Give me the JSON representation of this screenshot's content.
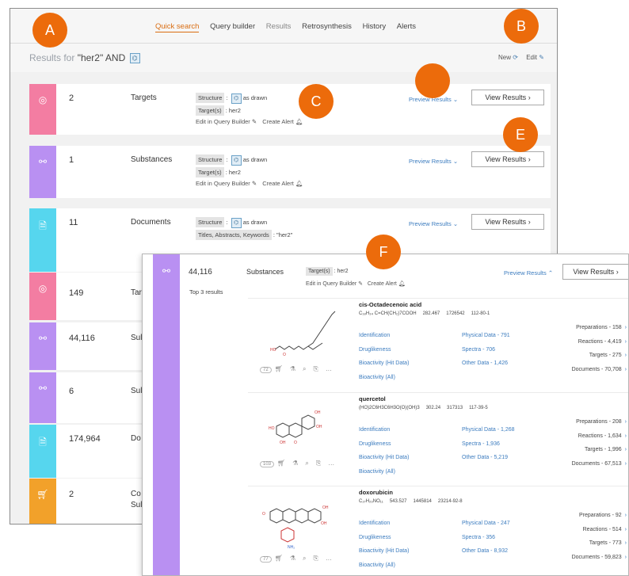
{
  "nav": [
    "Quick search",
    "Query builder",
    "Results",
    "Retrosynthesis",
    "History",
    "Alerts"
  ],
  "results_for": {
    "prefix": "Results for",
    "query": "\"her2\" AND"
  },
  "header_actions": {
    "new": "New",
    "edit": "Edit"
  },
  "annotations": {
    "a": "A",
    "b": "B",
    "c": "C",
    "d": "",
    "e": "E",
    "f": "F"
  },
  "rows": [
    {
      "count": "2",
      "label": "Targets",
      "line1_chip": "Structure",
      "line1_sep": ":",
      "line1_text": "as drawn",
      "line2_chip": "Target(s)",
      "line2_text": ": her2",
      "edit": "Edit in Query Builder",
      "alert": "Create Alert",
      "preview": "Preview Results",
      "view": "View Results"
    },
    {
      "count": "1",
      "label": "Substances",
      "line1_chip": "Structure",
      "line1_sep": ":",
      "line1_text": "as drawn",
      "line2_chip": "Target(s)",
      "line2_text": ": her2",
      "edit": "Edit in Query Builder",
      "alert": "Create Alert",
      "preview": "Preview Results",
      "view": "View Results"
    },
    {
      "count": "11",
      "label": "Documents",
      "line1_chip": "Structure",
      "line1_sep": ":",
      "line1_text": "as drawn",
      "line2_chip": "Titles, Abstracts, Keywords",
      "line2_text": ": \"her2\"",
      "preview": "Preview Results",
      "view": "View Results"
    },
    {
      "count": "149",
      "label": "Tar"
    },
    {
      "count": "44,116",
      "label": "Sul"
    },
    {
      "count": "6",
      "label": "Sul"
    },
    {
      "count": "174,964",
      "label": "Do"
    },
    {
      "count": "2",
      "label": "Co",
      "label2": "Sul"
    }
  ],
  "overlay": {
    "count": "44,116",
    "label": "Substances",
    "chip": "Target(s)",
    "chip_text": ": her2",
    "edit": "Edit in Query Builder",
    "alert": "Create Alert",
    "preview": "Preview Results",
    "view": "View Results",
    "top3": "Top 3 results",
    "results": [
      {
        "name": "cis-Octadecenoic acid",
        "formula": "C₁₈H₃₄ C=CH(CH₂)7COOH",
        "mw": "282.467",
        "reaxys_id": "1726542",
        "cas": "112-80-1",
        "badge": "72",
        "links_a": [
          "Identification",
          "Druglikeness",
          "Bioactivity (Hit Data)",
          "Bioactivity (All)"
        ],
        "links_b": [
          "Physical Data - 791",
          "Spectra - 706",
          "Other Data - 1,426"
        ],
        "counts": [
          "Preparations - 158",
          "Reactions - 4,419",
          "Targets - 275",
          "Documents - 70,708"
        ]
      },
      {
        "name": "quercetol",
        "formula": "(HO)2C6H3C6H3O(O)(OH)3",
        "mw": "302.24",
        "reaxys_id": "317313",
        "cas": "117-39-5",
        "badge": "103",
        "links_a": [
          "Identification",
          "Druglikeness",
          "Bioactivity (Hit Data)",
          "Bioactivity (All)"
        ],
        "links_b": [
          "Physical Data - 1,268",
          "Spectra - 1,936",
          "Other Data - 5,219"
        ],
        "counts": [
          "Preparations - 208",
          "Reactions - 1,634",
          "Targets - 1,996",
          "Documents - 67,513"
        ]
      },
      {
        "name": "doxorubicin",
        "formula": "C₂₇H₂₉NO₁₁",
        "mw": "543.527",
        "reaxys_id": "1445814",
        "cas": "23214-92-8",
        "badge": "77",
        "links_a": [
          "Identification",
          "Druglikeness",
          "Bioactivity (Hit Data)",
          "Bioactivity (All)"
        ],
        "links_b": [
          "Physical Data - 247",
          "Spectra - 356",
          "Other Data - 8,932"
        ],
        "counts": [
          "Preparations - 92",
          "Reactions - 514",
          "Targets - 773",
          "Documents - 59,823"
        ]
      }
    ]
  },
  "icons": {
    "target": "target-icon",
    "substance": "substance-icon",
    "document": "document-icon",
    "cart": "cart-icon",
    "structure": "structure-icon",
    "refresh": "refresh-icon",
    "pencil": "pencil-icon",
    "bell": "bell-icon",
    "chevron": "chevron-icon"
  }
}
